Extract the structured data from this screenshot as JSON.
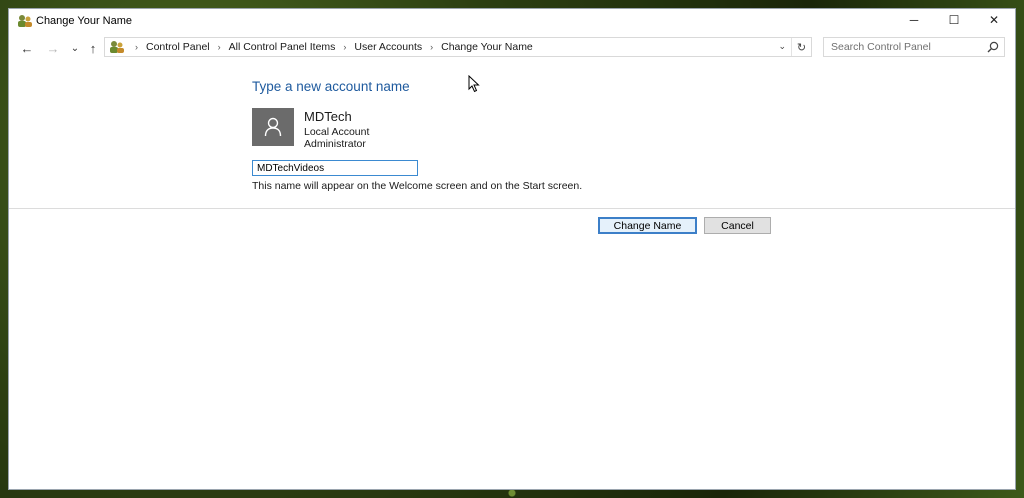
{
  "window": {
    "title": "Change Your Name",
    "minimize_glyph": "─",
    "maximize_glyph": "☐",
    "close_glyph": "✕"
  },
  "navigation": {
    "back_glyph": "←",
    "forward_glyph": "→",
    "recent_glyph": "⌄",
    "up_glyph": "↑",
    "breadcrumbs": [
      "Control Panel",
      "All Control Panel Items",
      "User Accounts",
      "Change Your Name"
    ],
    "separator": "›",
    "dropdown_glyph": "⌄",
    "refresh_glyph": "↻",
    "search_placeholder": "Search Control Panel"
  },
  "content": {
    "heading": "Type a new account name",
    "account": {
      "name": "MDTech",
      "type": "Local Account",
      "role": "Administrator"
    },
    "new_name_value": "MDTechVideos",
    "hint": "This name will appear on the Welcome screen and on the Start screen."
  },
  "buttons": {
    "change_name": "Change Name",
    "cancel": "Cancel"
  },
  "colors": {
    "heading": "#1e5a9e",
    "focus_border": "#3b8ad1",
    "primary_button_border": "#3c7fc8"
  },
  "icons": {
    "app": "control-panel-users-icon",
    "avatar": "user-silhouette-icon",
    "search": "magnifier-icon",
    "cursor": "mouse-pointer-icon"
  }
}
